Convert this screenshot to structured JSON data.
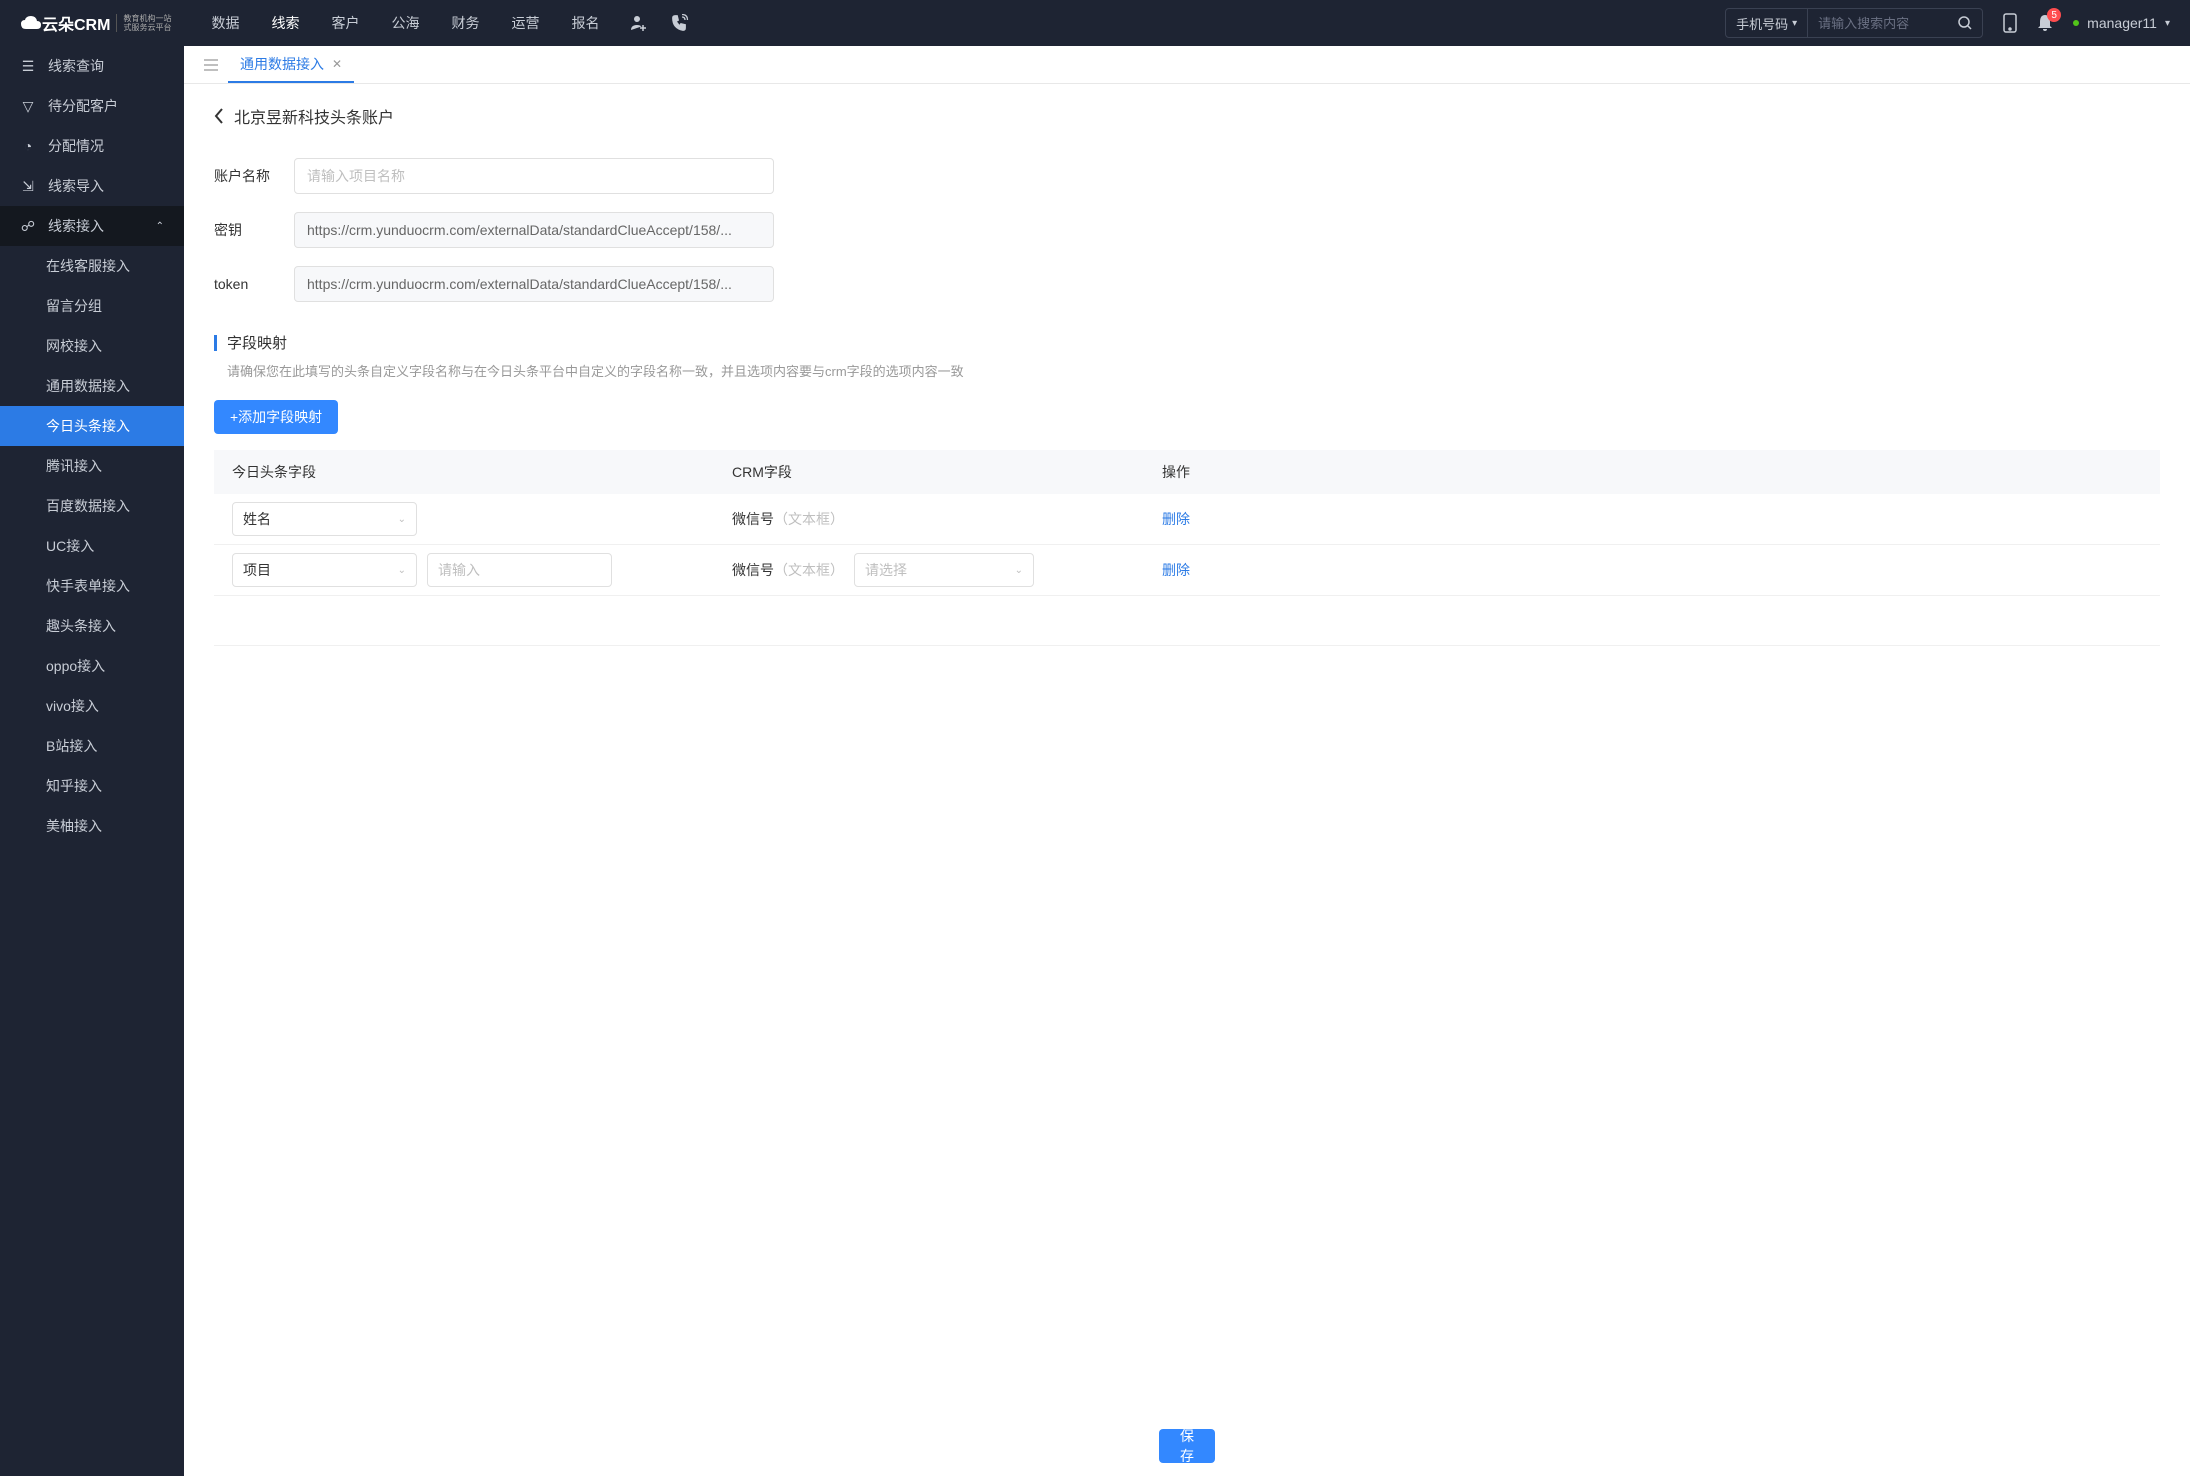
{
  "header": {
    "logo": "云朵CRM",
    "logo_sub1": "教育机构一站",
    "logo_sub2": "式服务云平台",
    "nav": [
      "数据",
      "线索",
      "客户",
      "公海",
      "财务",
      "运营",
      "报名"
    ],
    "nav_active": 1,
    "search_type": "手机号码",
    "search_placeholder": "请输入搜索内容",
    "notif_count": "5",
    "username": "manager11"
  },
  "sidebar": {
    "top": [
      {
        "label": "线索查询"
      },
      {
        "label": "待分配客户"
      },
      {
        "label": "分配情况"
      },
      {
        "label": "线索导入"
      }
    ],
    "expand_label": "线索接入",
    "subs": [
      "在线客服接入",
      "留言分组",
      "网校接入",
      "通用数据接入",
      "今日头条接入",
      "腾讯接入",
      "百度数据接入",
      "UC接入",
      "快手表单接入",
      "趣头条接入",
      "oppo接入",
      "vivo接入",
      "B站接入",
      "知乎接入",
      "美柚接入"
    ],
    "active_sub": 4
  },
  "tabs": {
    "active": "通用数据接入"
  },
  "page": {
    "title": "北京昱新科技头条账户",
    "account_name_label": "账户名称",
    "account_name_placeholder": "请输入项目名称",
    "key_label": "密钥",
    "key_value": "https://crm.yunduocrm.com/externalData/standardClueAccept/158/...",
    "token_label": "token",
    "token_value": "https://crm.yunduocrm.com/externalData/standardClueAccept/158/...",
    "mapping_title": "字段映射",
    "mapping_desc": "请确保您在此填写的头条自定义字段名称与在今日头条平台中自定义的字段名称一致，并且选项内容要与crm字段的选项内容一致",
    "add_btn": "+添加字段映射",
    "table_headers": {
      "col1": "今日头条字段",
      "col2": "CRM字段",
      "col3": "操作"
    },
    "rows": [
      {
        "field_select": "姓名",
        "crm_label": "微信号",
        "crm_hint": "（文本框）",
        "delete": "删除"
      },
      {
        "field_select": "项目",
        "input_placeholder": "请输入",
        "crm_label": "微信号",
        "crm_hint": "（文本框）",
        "crm_select_placeholder": "请选择",
        "delete": "删除"
      }
    ],
    "save": "保存"
  }
}
